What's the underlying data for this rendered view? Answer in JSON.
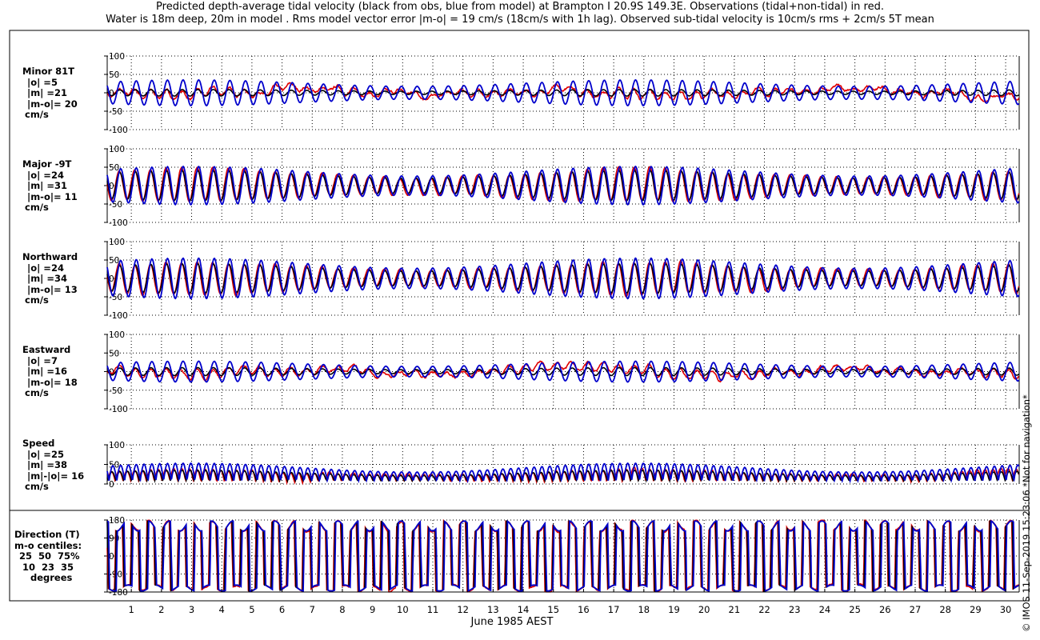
{
  "title_line1": "Predicted depth-average tidal velocity (black from obs, blue from model) at Brampton I 20.9S 149.3E. Observations (tidal+non-tidal) in red.",
  "title_line2": "Water is 18m deep, 20m in model . Rms model vector error |m-o| = 19 cm/s (18cm/s with 1h lag). Observed sub-tidal velocity is 10cm/s rms + 2cm/s 5T mean",
  "credit": "© IMOS 11-Sep-2019 15:23:06  *Not for navigation*",
  "colors": {
    "observed": "#e00000",
    "tide_from_obs": "#000000",
    "model": "#0000cc"
  },
  "chart_data": {
    "type": "line",
    "xlabel": "June 1985 AEST",
    "x_ticks": [
      "1",
      "2",
      "3",
      "4",
      "5",
      "6",
      "7",
      "8",
      "9",
      "10",
      "11",
      "12",
      "13",
      "14",
      "15",
      "16",
      "17",
      "18",
      "19",
      "20",
      "21",
      "22",
      "23",
      "24",
      "25",
      "26",
      "27",
      "28",
      "29",
      "30"
    ],
    "xlim_days": [
      0.2,
      30.45
    ],
    "grid": true,
    "panels": [
      {
        "id": "minor",
        "label_lines": [
          "Minor 81T",
          "|o| =5",
          "|m| =21",
          "|m-o|= 20",
          "cm/s"
        ],
        "yticks": [
          "-100",
          "-50",
          "0",
          "50",
          "100"
        ],
        "ylim": [
          -100,
          100
        ],
        "series": {
          "obs_tide_amp": 10,
          "model_amp": 35,
          "obs_noise": 15
        }
      },
      {
        "id": "major",
        "label_lines": [
          "Major -9T",
          "|o| =24",
          "|m| =31",
          "|m-o|= 11",
          "cm/s"
        ],
        "yticks": [
          "-100",
          "-50",
          "0",
          "50",
          "100"
        ],
        "ylim": [
          -100,
          100
        ],
        "series": {
          "obs_tide_amp": 45,
          "model_amp": 52,
          "obs_noise": 6
        }
      },
      {
        "id": "northward",
        "label_lines": [
          "Northward",
          "|o| =24",
          "|m| =34",
          "|m-o|= 13",
          "cm/s"
        ],
        "yticks": [
          "-100",
          "-50",
          "0",
          "50",
          "100"
        ],
        "ylim": [
          -100,
          100
        ],
        "series": {
          "obs_tide_amp": 44,
          "model_amp": 55,
          "obs_noise": 6
        }
      },
      {
        "id": "eastward",
        "label_lines": [
          "Eastward",
          "|o| =7",
          "|m| =16",
          "|m-o|= 18",
          "cm/s"
        ],
        "yticks": [
          "-100",
          "-50",
          "0",
          "50",
          "100"
        ],
        "ylim": [
          -100,
          100
        ],
        "series": {
          "obs_tide_amp": 12,
          "model_amp": 28,
          "obs_noise": 14
        }
      },
      {
        "id": "speed",
        "label_lines": [
          "Speed",
          "|o| =25",
          "|m| =38",
          "|m|-|o|= 16",
          "cm/s"
        ],
        "yticks": [
          "0",
          "50",
          "100"
        ],
        "ylim": [
          0,
          100
        ],
        "series": {
          "obs_tide_amp": 30,
          "model_amp": 45,
          "obs_noise": 6
        }
      },
      {
        "id": "direction",
        "label_lines": [
          "Direction (T)",
          "m-o centiles:",
          "25  50  75%",
          "10  23  35",
          "degrees"
        ],
        "yticks": [
          "-180",
          "-90",
          "0",
          "90",
          "180"
        ],
        "ylim": [
          -180,
          180
        ],
        "series": {
          "obs_tide_amp": 180,
          "model_amp": 180,
          "obs_noise": 10
        }
      }
    ]
  }
}
